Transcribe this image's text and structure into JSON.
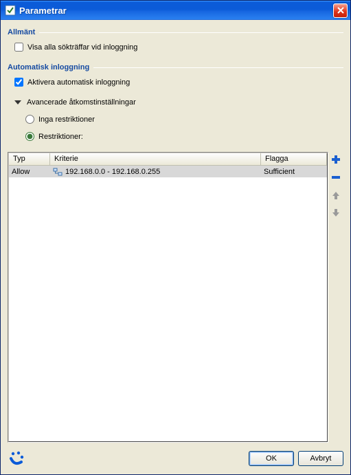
{
  "window": {
    "title": "Parametrar"
  },
  "groups": {
    "general": "Allmänt",
    "autologin": "Automatisk inloggning"
  },
  "general": {
    "show_search_hits": "Visa alla sökträffar vid inloggning"
  },
  "autologin": {
    "activate": "Aktivera automatisk inloggning",
    "advanced": "Avancerade åtkomstinställningar",
    "no_restrictions": "Inga restriktioner",
    "restrictions": "Restriktioner:"
  },
  "table": {
    "headers": {
      "typ": "Typ",
      "kriterie": "Kriterie",
      "flagga": "Flagga"
    },
    "rows": [
      {
        "typ": "Allow",
        "kriterie": "192.168.0.0 - 192.168.0.255",
        "flagga": "Sufficient"
      }
    ]
  },
  "buttons": {
    "ok": "OK",
    "cancel": "Avbryt"
  }
}
